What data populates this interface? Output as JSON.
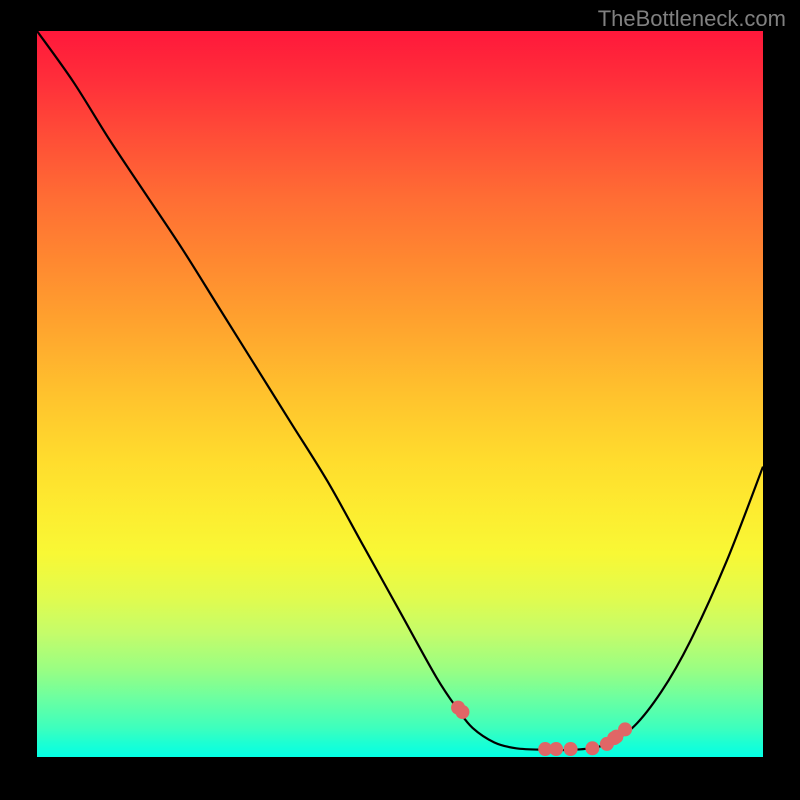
{
  "watermark": "TheBottleneck.com",
  "chart_data": {
    "type": "line",
    "title": "",
    "xlabel": "",
    "ylabel": "",
    "xlim": [
      0,
      100
    ],
    "ylim": [
      0,
      100
    ],
    "x": [
      0,
      5,
      10,
      15,
      20,
      25,
      30,
      35,
      40,
      45,
      50,
      55,
      58,
      60,
      63,
      66,
      70,
      74,
      78,
      82,
      86,
      90,
      95,
      100
    ],
    "values": [
      100,
      93,
      85,
      77.5,
      70,
      62,
      54,
      46,
      38,
      29,
      20,
      11,
      6.5,
      4,
      2,
      1.2,
      1,
      1,
      1.6,
      4,
      9,
      16,
      27,
      40
    ],
    "markers": {
      "x": [
        58,
        58.6,
        70,
        71.5,
        73.5,
        76.5,
        78.5,
        79.5,
        79.8,
        81
      ],
      "y": [
        6.8,
        6.2,
        1.1,
        1.1,
        1.1,
        1.2,
        1.8,
        2.6,
        2.8,
        3.8
      ],
      "color": "#e06666",
      "size": 7
    },
    "curve_color": "#000000",
    "gradient": {
      "top": "#ff183b",
      "bottom": "#04ffe5"
    }
  }
}
